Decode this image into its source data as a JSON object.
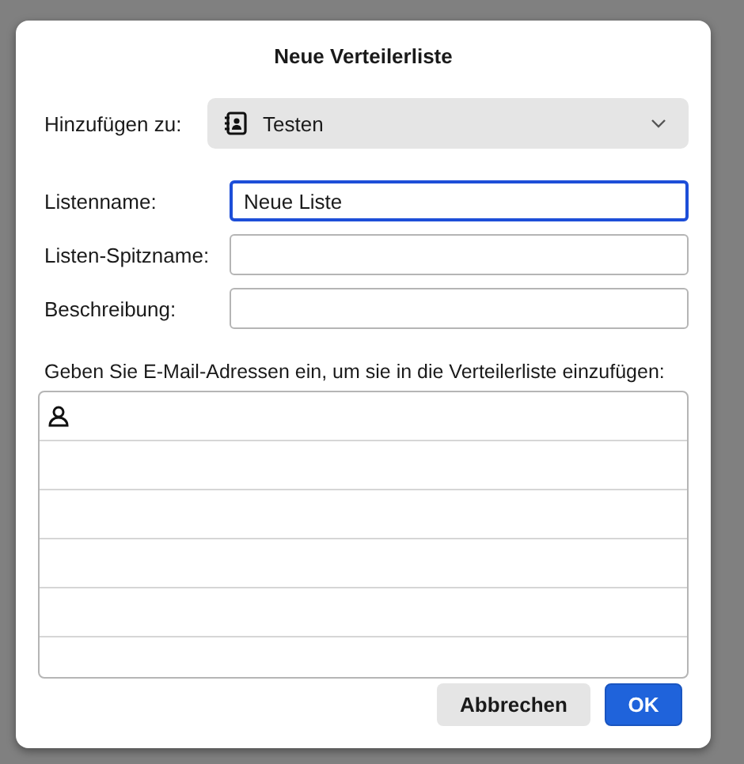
{
  "dialog": {
    "title": "Neue Verteilerliste"
  },
  "add_to": {
    "label": "Hinzufügen zu:",
    "value": "Testen"
  },
  "fields": [
    {
      "label": "Listenname:",
      "value": "Neue Liste",
      "focused": true
    },
    {
      "label": "Listen-Spitzname:",
      "focused": false
    },
    {
      "label": "Beschreibung:",
      "focused": false
    }
  ],
  "instruction": "Geben Sie E-Mail-Adressen ein, um sie in die Verteilerliste einzufügen:",
  "address_rows": [
    {
      "kind": "contact"
    },
    {
      "kind": "empty"
    },
    {
      "kind": "empty"
    },
    {
      "kind": "empty"
    },
    {
      "kind": "empty"
    },
    {
      "kind": "empty"
    }
  ],
  "buttons": [
    {
      "label": "Abbrechen",
      "kind": "secondary"
    },
    {
      "label": "OK",
      "kind": "primary"
    }
  ]
}
